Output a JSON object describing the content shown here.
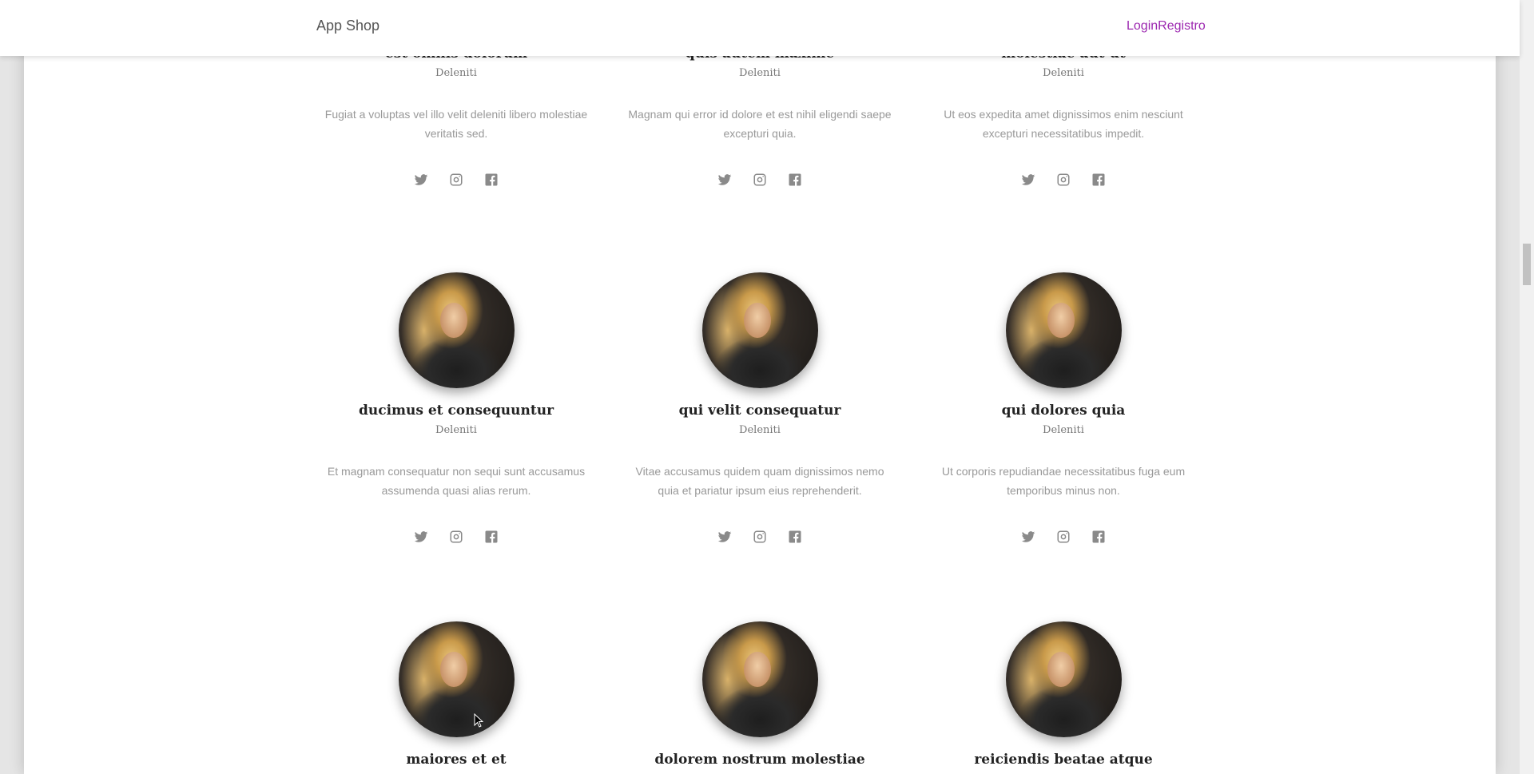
{
  "navbar": {
    "brand": "App Shop",
    "links": {
      "login": "Login",
      "register": "Registro"
    }
  },
  "team": [
    {
      "name": "est omnis dolorum",
      "role": "Deleniti",
      "description": "Fugiat a voluptas vel illo velit deleniti libero molestiae veritatis sed.",
      "socials": [
        "twitter-icon",
        "instagram-icon",
        "facebook-icon"
      ]
    },
    {
      "name": "quis autem maxime",
      "role": "Deleniti",
      "description": "Magnam qui error id dolore et est nihil eligendi saepe excepturi quia.",
      "socials": [
        "twitter-icon",
        "instagram-icon",
        "facebook-icon"
      ]
    },
    {
      "name": "molestiae aut ut",
      "role": "Deleniti",
      "description": "Ut eos expedita amet dignissimos enim nesciunt excepturi necessitatibus impedit.",
      "socials": [
        "twitter-icon",
        "instagram-icon",
        "facebook-icon"
      ]
    },
    {
      "name": "ducimus et consequuntur",
      "role": "Deleniti",
      "description": "Et magnam consequatur non sequi sunt accusamus assumenda quasi alias rerum.",
      "socials": [
        "twitter-icon",
        "instagram-icon",
        "facebook-icon"
      ]
    },
    {
      "name": "qui velit consequatur",
      "role": "Deleniti",
      "description": "Vitae accusamus quidem quam dignissimos nemo quia et pariatur ipsum eius reprehenderit.",
      "socials": [
        "twitter-icon",
        "instagram-icon",
        "facebook-icon"
      ]
    },
    {
      "name": "qui dolores quia",
      "role": "Deleniti",
      "description": "Ut corporis repudiandae necessitatibus fuga eum temporibus minus non.",
      "socials": [
        "twitter-icon",
        "instagram-icon",
        "facebook-icon"
      ]
    },
    {
      "name": "maiores et et"
    },
    {
      "name": "dolorem nostrum molestiae"
    },
    {
      "name": "reiciendis beatae atque"
    }
  ],
  "colors": {
    "accent": "#9c27b0",
    "brand_text": "#555555",
    "muted_text": "#999999",
    "icon": "#8a8a8a"
  }
}
